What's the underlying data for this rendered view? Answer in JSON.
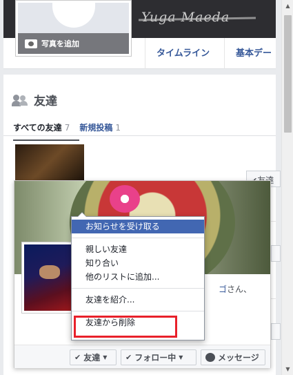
{
  "profile": {
    "username": "Yuga Maeda",
    "add_photo_label": "写真を追加"
  },
  "tabs": [
    {
      "label": "タイムライン"
    },
    {
      "label": "基本デー"
    }
  ],
  "friends": {
    "title": "友達",
    "subtabs": [
      {
        "label": "すべての友達",
        "count": "7"
      },
      {
        "label": "新規投稿",
        "count": "1"
      }
    ],
    "row_button_partial": "友達"
  },
  "hovercard": {
    "name_suffix_link": "ゴ",
    "name_suffix": "さん、",
    "buttons": {
      "friends": "友達",
      "following": "フォロー中",
      "message": "メッセージ"
    }
  },
  "menu": {
    "items": [
      {
        "label": "お知らせを受け取る",
        "active": true
      },
      {
        "label": "親しい友達"
      },
      {
        "label": "知り合い"
      },
      {
        "label": "他のリストに追加..."
      },
      {
        "label": "友達を紹介..."
      },
      {
        "label": "友達から削除"
      }
    ]
  },
  "colors": {
    "accent": "#4267b2",
    "highlight": "#e8202a",
    "link": "#365899"
  }
}
